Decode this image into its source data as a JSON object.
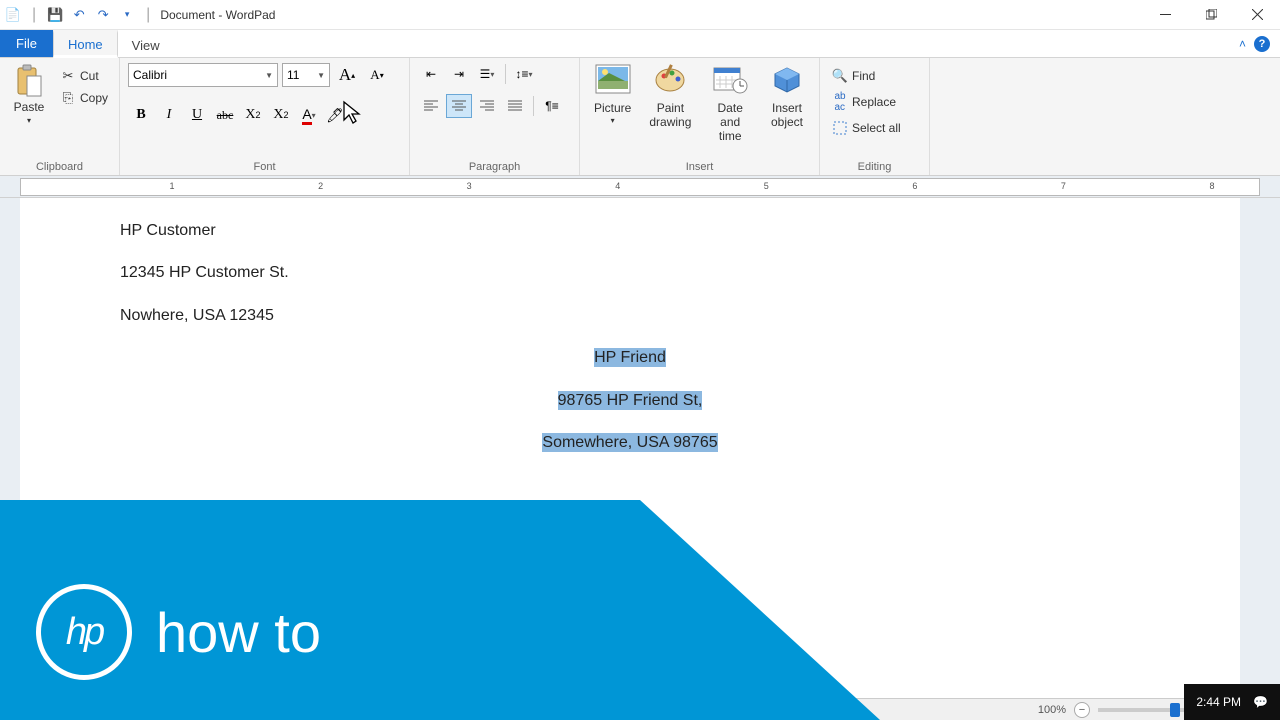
{
  "title": "Document - WordPad",
  "tabs": {
    "file": "File",
    "home": "Home",
    "view": "View"
  },
  "clipboard": {
    "paste": "Paste",
    "cut": "Cut",
    "copy": "Copy",
    "label": "Clipboard"
  },
  "font": {
    "family": "Calibri",
    "size": "11",
    "label": "Font"
  },
  "paragraph": {
    "label": "Paragraph"
  },
  "insert": {
    "picture": "Picture",
    "paint": "Paint\ndrawing",
    "datetime": "Date and\ntime",
    "object": "Insert\nobject",
    "label": "Insert"
  },
  "editing": {
    "find": "Find",
    "replace": "Replace",
    "selectall": "Select all",
    "label": "Editing"
  },
  "ruler": [
    "1",
    "2",
    "3",
    "4",
    "5",
    "6",
    "7",
    "8"
  ],
  "doc": {
    "l1": "HP Customer",
    "l2": "12345 HP Customer St.",
    "l3": "Nowhere, USA 12345",
    "r1": "HP Friend",
    "r2": "98765 HP Friend St,",
    "r3": "Somewhere,  USA 98765"
  },
  "status": {
    "zoom": "100%"
  },
  "taskbar": {
    "time": "2:44 PM"
  },
  "overlay": {
    "text": "how to",
    "logo": "hp"
  }
}
